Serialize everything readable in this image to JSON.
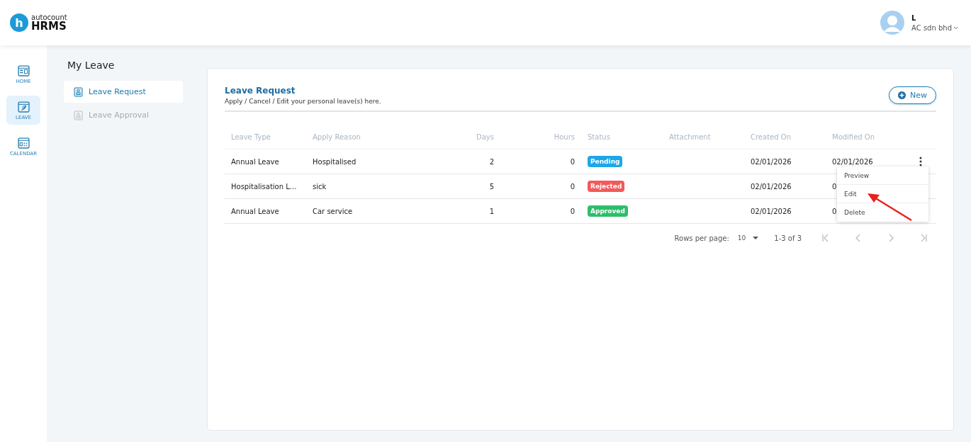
{
  "header": {
    "logo": {
      "mark": "h",
      "brand": "autocount",
      "product": "HRMS"
    },
    "user": {
      "name": "L",
      "company": "AC sdn bhd"
    }
  },
  "nav": [
    {
      "label": "HOME",
      "selected": false
    },
    {
      "label": "LEAVE",
      "selected": true
    },
    {
      "label": "CALENDAR",
      "selected": false
    }
  ],
  "page_title": "My Leave",
  "submenu": [
    {
      "label": "Leave Request",
      "selected": true
    },
    {
      "label": "Leave Approval",
      "selected": false
    }
  ],
  "card": {
    "title": "Leave Request",
    "subtitle": "Apply / Cancel / Edit your personal leave(s) here.",
    "new_button": "New"
  },
  "table": {
    "columns": [
      "Leave Type",
      "Apply Reason",
      "Days",
      "Hours",
      "Status",
      "Attachment",
      "Created On",
      "Modified On"
    ],
    "rows": [
      {
        "leave_type": "Annual Leave",
        "reason": "Hospitalised",
        "days": "2",
        "hours": "0",
        "status": {
          "label": "Pending",
          "color": "#1ea7e8"
        },
        "created": "02/01/2026",
        "modified": "02/01/2026"
      },
      {
        "leave_type": "Hospitalisation L...",
        "reason": "sick",
        "days": "5",
        "hours": "0",
        "status": {
          "label": "Rejected",
          "color": "#f25a5a"
        },
        "created": "02/01/2026",
        "modified": "0"
      },
      {
        "leave_type": "Annual Leave",
        "reason": "Car service",
        "days": "1",
        "hours": "0",
        "status": {
          "label": "Approved",
          "color": "#2fbd6a"
        },
        "created": "02/01/2026",
        "modified": "0"
      }
    ]
  },
  "row_menu": {
    "items": [
      "Preview",
      "Edit",
      "Delete"
    ]
  },
  "pagination": {
    "rows_label": "Rows per page:",
    "rows_value": "10",
    "range": "1-3 of 3"
  }
}
